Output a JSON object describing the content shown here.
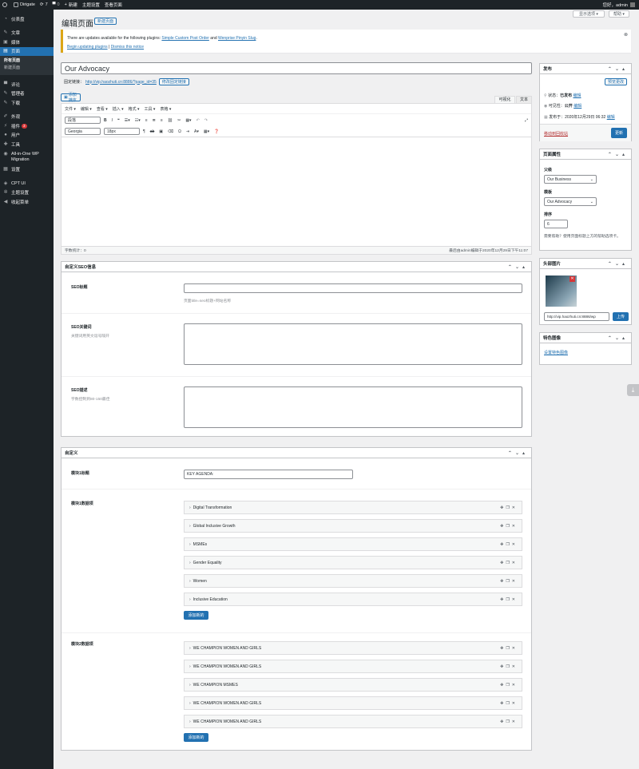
{
  "adminbar": {
    "site": "Dirigate",
    "updates": "7",
    "comments": "0",
    "new": "新建",
    "theme_settings": "主题设置",
    "view_page": "查看页面",
    "howdy": "您好，admin"
  },
  "sidebar": {
    "items": [
      {
        "label": "仪表盘",
        "icon": "dashboard-icon"
      },
      {
        "label": "文章",
        "icon": "pin-icon"
      },
      {
        "label": "媒体",
        "icon": "media-icon"
      },
      {
        "label": "页面",
        "icon": "page-icon"
      },
      {
        "label": "评论",
        "icon": "comment-icon"
      },
      {
        "label": "管理者",
        "icon": "pin-icon"
      },
      {
        "label": "下载",
        "icon": "pin-icon"
      },
      {
        "label": "外观",
        "icon": "brush-icon"
      },
      {
        "label": "插件",
        "icon": "plugin-icon",
        "badge": "3"
      },
      {
        "label": "用户",
        "icon": "user-icon"
      },
      {
        "label": "工具",
        "icon": "wrench-icon"
      },
      {
        "label": "All-in-One WP Migration",
        "icon": "migration-icon"
      },
      {
        "label": "设置",
        "icon": "settings-icon"
      },
      {
        "label": "CPT UI",
        "icon": "cpt-icon"
      },
      {
        "label": "主题设置",
        "icon": "gear-icon"
      },
      {
        "label": "收起菜单",
        "icon": "collapse-icon"
      }
    ],
    "submenu": [
      "所有页面",
      "新建页面"
    ]
  },
  "screen_options": "显示选项 ▾",
  "help": "帮助 ▾",
  "page_title": "编辑页面",
  "new_page_btn": "新建页面",
  "notice": {
    "text1": "There are updates available for the following plugins: ",
    "plugin1": "Simple Custom Post Order",
    "and": " and ",
    "plugin2": "Wenprise Pinyin Slug",
    "dot": ".",
    "link1": "Begin updating plugins",
    "sep": " | ",
    "link2": "Dismiss this notice"
  },
  "post_title": "Our Advocacy",
  "permalink": {
    "label": "固定链接：",
    "url": "http://vip.haozhuti.cn:8886/?page_id=35",
    "btn": "修改固定链接"
  },
  "editor": {
    "add_media": "添加媒体",
    "tab_visual": "可视化",
    "tab_text": "文本",
    "menu": [
      "文件 ▾",
      "编辑 ▾",
      "查看 ▾",
      "插入 ▾",
      "格式 ▾",
      "工具 ▾",
      "表格 ▾"
    ],
    "block": "段落",
    "font": "Georgia",
    "size": "18px",
    "word_count": "字数统计：0",
    "last_edit": "最后由admin编辑于2020年12月29日下午11:07"
  },
  "seo": {
    "title": "自定义SEO信息",
    "f1_label": "SEO标题",
    "f1_hint": "页面title=seo标题+网站名称",
    "f2_label": "SEO关键词",
    "f2_hint": "关键词用英文逗号隔开",
    "f3_label": "SEO描述",
    "f3_hint": "字数控制到80-150最佳"
  },
  "custom": {
    "title": "自定义",
    "m1_title_label": "模块1标题",
    "m1_title_value": "KEY AGENDA:",
    "m1_data_label": "模块1数据项",
    "m1_items": [
      "Digital Transformation",
      "Global Inclusive Growth",
      "MSMEs",
      "Gender Equality",
      "Women",
      "Inclusive Education"
    ],
    "add_new": "添加新的",
    "m2_data_label": "模块2数据项",
    "m2_items": [
      "WE CHAMPION WOMEN AND GIRLS",
      "WE CHAMPION WOMEN AND GIRLS",
      "WE CHAMPION MSMES",
      "WE CHAMPION WOMEN AND GIRLS",
      "WE CHAMPION WOMEN AND GIRLS"
    ]
  },
  "publish": {
    "title": "发布",
    "preview": "预览更改",
    "status_label": "状态：",
    "status": "已发布",
    "edit": "编辑",
    "visibility_label": "可见性：",
    "visibility": "公开",
    "published_label": "发布于：",
    "published": "2020年12月29日 06:32",
    "trash": "移动到回收站",
    "update": "更新"
  },
  "attributes": {
    "title": "页面属性",
    "parent_label": "父级",
    "parent": "Our Business",
    "template_label": "模板",
    "template": "Our Advocacy",
    "order_label": "排序",
    "order": "6",
    "help": "需要帮助？使用页面标题上方的帮助选项卡。"
  },
  "header_image": {
    "title": "头部图片",
    "url": "http://vip.haozhuti.cn:8886/wp",
    "upload": "上传"
  },
  "featured": {
    "title": "特色图像",
    "link": "设置特色图像"
  }
}
